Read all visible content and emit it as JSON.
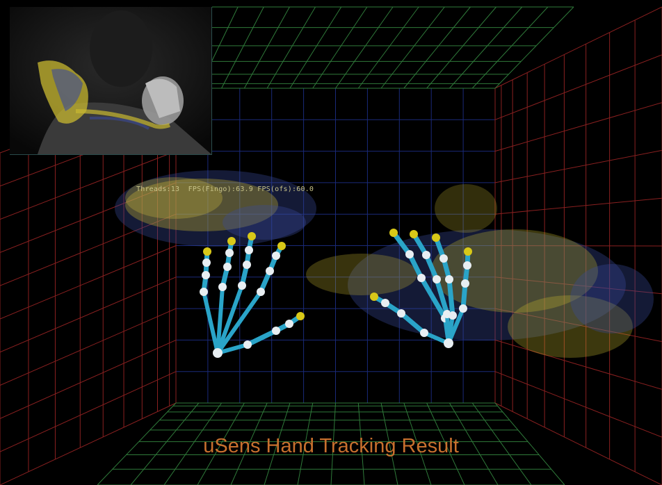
{
  "stats": {
    "threads_label": "Threads:",
    "threads_value": "13",
    "fps_fingo_label": "FPS(Fingo):",
    "fps_fingo_value": "63.9",
    "fps_ofs_label": "FPS(ofs):",
    "fps_ofs_value": "60.0"
  },
  "caption": "uSens Hand Tracking Result",
  "colors": {
    "background": "#000000",
    "grid_floor": "#2f7a3a",
    "grid_side": "#8a2020",
    "grid_back": "#1a2a7a",
    "bone": "#2aa4c8",
    "joint": "#e8eef2",
    "fingertip": "#d8c818",
    "point_cloud_yellow": "#c8b830",
    "point_cloud_blue": "#3a4a9a",
    "caption": "#c8702e",
    "stats_text": "#c9c489"
  },
  "icons": {
    "left_hand": "hand-skeleton-left-icon",
    "right_hand": "hand-skeleton-right-icon",
    "camera_inset": "camera-feed-thumbnail"
  }
}
